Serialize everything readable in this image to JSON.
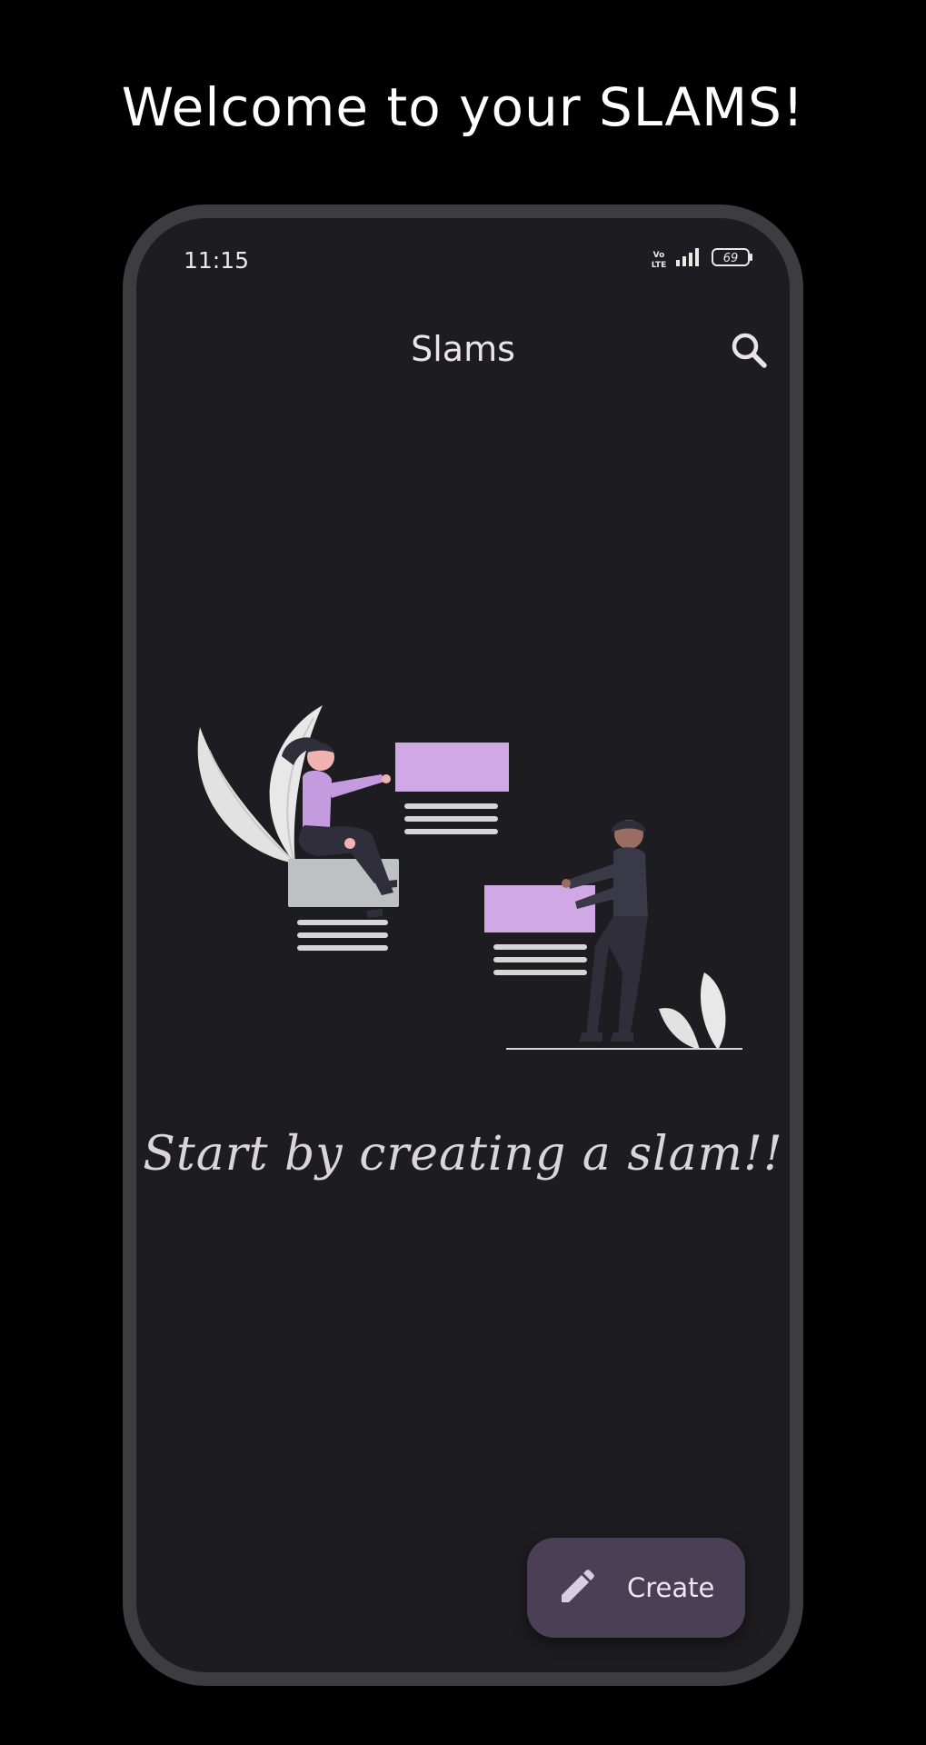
{
  "headline": "Welcome to your SLAMS!",
  "status_bar": {
    "time": "11:15",
    "volte": "Vo LTE",
    "battery": "69"
  },
  "app_bar": {
    "title": "Slams",
    "search_icon": "search-icon"
  },
  "empty_state": {
    "illustration": "two-people-with-cards-illustration",
    "message": "Start by creating a slam!!"
  },
  "fab": {
    "label": "Create",
    "icon": "pencil-icon"
  },
  "colors": {
    "accent_purple": "#d0a8e6",
    "fab_background": "#4b3f55",
    "screen_background": "#1d1c20"
  }
}
